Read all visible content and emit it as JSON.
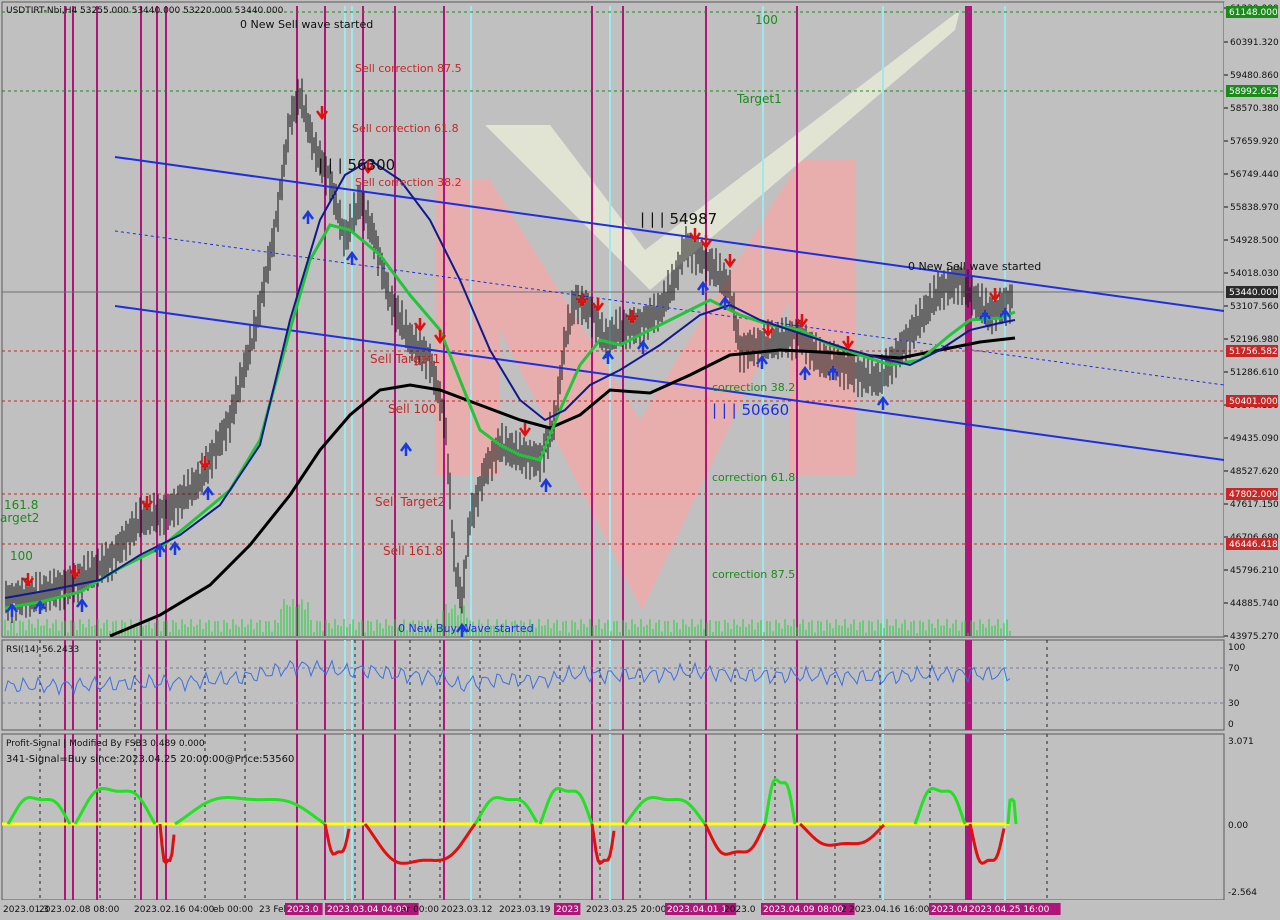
{
  "header": {
    "symbol_line": "USDTIRT-Nbi,H4  53255.000 53440.000 53220.000 53440.000"
  },
  "price_axis": {
    "ticks": [
      "61220.000",
      "60391.320",
      "59480.860",
      "58570.380",
      "57659.920",
      "56749.440",
      "55838.970",
      "54928.500",
      "54018.030",
      "53107.560",
      "52196.980",
      "51286.610",
      "50376.130",
      "49435.090",
      "48527.620",
      "47617.150",
      "46706.680",
      "45796.210",
      "44885.740",
      "43975.270"
    ],
    "badges": [
      {
        "id": "target-top",
        "text": "61148.000",
        "color": "#1d8a1d"
      },
      {
        "id": "target1",
        "text": "58992.652",
        "color": "#1d8a1d"
      },
      {
        "id": "current",
        "text": "53440.000",
        "color": "#2b2b2b"
      },
      {
        "id": "sell-target1",
        "text": "51756.582",
        "color": "#c62828"
      },
      {
        "id": "sell-100",
        "text": "50401.000",
        "color": "#c62828"
      },
      {
        "id": "sell-target2",
        "text": "47802.000",
        "color": "#c62828"
      },
      {
        "id": "sell-161",
        "text": "46446.418",
        "color": "#c62828"
      }
    ]
  },
  "annotations": {
    "new_sell_top": "0 New Sell wave started",
    "new_sell_right": "0 New Sell wave started",
    "new_buy_bottom": "0 New Buy Wave started",
    "sell_corr_875": "Sell correction 87.5",
    "sell_corr_618": "Sell correction 61.8",
    "sell_corr_382": "Sell correction 38.2",
    "sell_target1": "Sell Target1",
    "sell_100": "Sell 100",
    "sell_target2": "Sell Target2",
    "sell_1618": "Sell 161.8",
    "label_100_top": "100",
    "label_target1": "Target1",
    "corr_382": "correction 38.2",
    "corr_618": "correction 61.8",
    "corr_875": "correction 87.5",
    "left_1618": "161.8",
    "left_target2": "arget2",
    "left_100": "100",
    "peak1": "| | | 56300",
    "peak2": "| | | 54987",
    "trough": "| | | 50660"
  },
  "rsi": {
    "label": "RSI(14) 56.2433",
    "ticks": [
      "100",
      "70",
      "30",
      "0"
    ]
  },
  "profit_signal": {
    "line1": "Profit-Signal | Modified By FSB3 0.489 0.000",
    "line2": "341-Signal=Buy since:2023.04.25 20:00:00@Price:53560",
    "ticks": [
      "3.071",
      "0.00",
      "-2.564"
    ]
  },
  "time_axis": {
    "labels": [
      "2023.01.3",
      "2023.02.08 08:00",
      "2023.02.16 04:00",
      "eb 00:00",
      "23 Feb",
      "2023.0",
      "2023.03.04 04:00",
      "ar 00:00",
      "2023.03.12",
      "2023.03.19",
      "2023",
      "2023.03.25 20:00",
      "2023.04.01 1",
      "2023.0",
      "2023.04.09 08:00",
      "2",
      "2023.04.16 16:00",
      "2023.04",
      "2023.04.25 16:00"
    ]
  },
  "colors": {
    "background": "#c0c0c0",
    "channel": "#1f2fe0",
    "ma_green": "#22c43a",
    "ma_navy": "#101a8a",
    "ma_black": "#000000",
    "magenta": "#b0157a",
    "cyan": "#9ee8ee",
    "sell_arrow": "#e01010",
    "buy_arrow": "#1a3ae0",
    "signal_green": "#22e022",
    "signal_red": "#e01010",
    "signal_yellow": "#ffff00"
  }
}
